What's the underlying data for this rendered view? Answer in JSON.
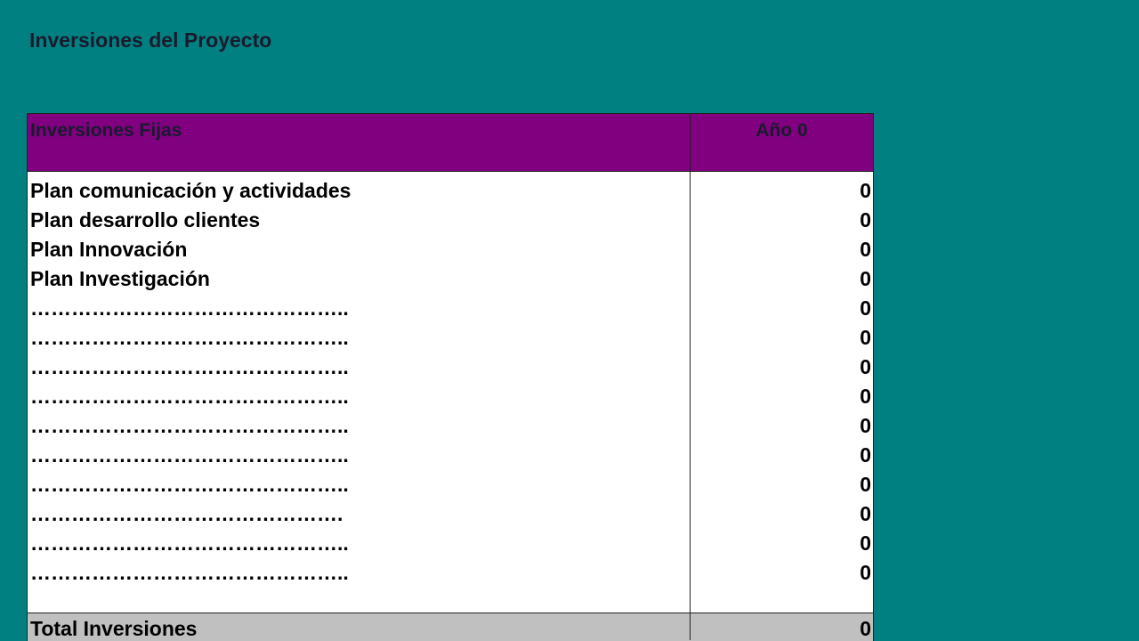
{
  "title": "Inversiones del Proyecto",
  "table": {
    "header": {
      "label": "Inversiones Fijas",
      "year": "Año 0"
    },
    "rows": [
      {
        "label": "Plan comunicación y actividades",
        "value": "0"
      },
      {
        "label": "Plan desarrollo clientes",
        "value": "0"
      },
      {
        "label": "Plan Innovación",
        "value": "0"
      },
      {
        "label": "Plan Investigación",
        "value": "0"
      },
      {
        "label": "………………………………………..",
        "value": "0"
      },
      {
        "label": "………………………………………..",
        "value": "0"
      },
      {
        "label": "………………………………………..",
        "value": "0"
      },
      {
        "label": "………………………………………..",
        "value": "0"
      },
      {
        "label": "………………………………………..",
        "value": "0"
      },
      {
        "label": "………………………………………..",
        "value": "0"
      },
      {
        "label": "………………………………………..",
        "value": "0"
      },
      {
        "label": "……………………………………….",
        "value": "0"
      },
      {
        "label": "………………………………………..",
        "value": "0"
      },
      {
        "label": "………………………………………..",
        "value": "0"
      }
    ],
    "total": {
      "label": "Total Inversiones",
      "value": "0"
    }
  },
  "colors": {
    "background": "#008080",
    "header": "#800080",
    "total_row": "#c0c0c0"
  }
}
